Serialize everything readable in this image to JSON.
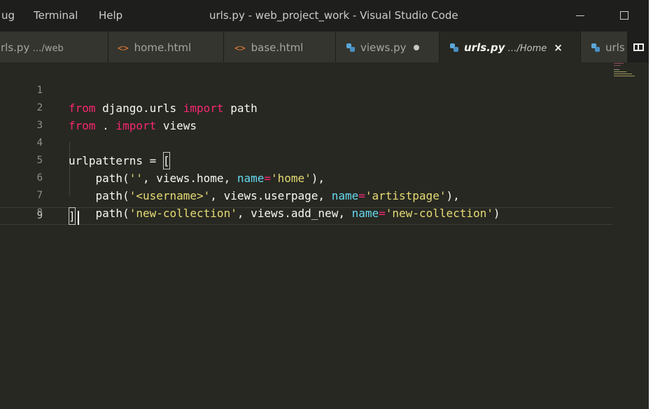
{
  "menu": {
    "items": [
      "ug",
      "Terminal",
      "Help"
    ]
  },
  "window": {
    "title": "urls.py - web_project_work - Visual Studio Code"
  },
  "tabs": [
    {
      "name": "rls.py",
      "path": " …/web",
      "icon": "python-icon",
      "active": false,
      "dirty": false
    },
    {
      "name": "home.html",
      "path": "",
      "icon": "html-icon",
      "active": false,
      "dirty": false
    },
    {
      "name": "base.html",
      "path": "",
      "icon": "html-icon",
      "active": false,
      "dirty": false
    },
    {
      "name": "views.py",
      "path": "",
      "icon": "python-icon",
      "active": false,
      "dirty": true
    },
    {
      "name": "urls.py",
      "path": " …/Home",
      "icon": "python-icon",
      "active": true,
      "dirty": false
    },
    {
      "name": "urls",
      "path": "",
      "icon": "python-icon",
      "active": false,
      "dirty": false
    }
  ],
  "tab_icons": {
    "html_glyph": "<>",
    "close_glyph": "×"
  },
  "editor": {
    "current_line": 9,
    "lines": [
      {
        "num": "1"
      },
      {
        "num": "2"
      },
      {
        "num": "3"
      },
      {
        "num": "4"
      },
      {
        "num": "5"
      },
      {
        "num": "6"
      },
      {
        "num": "7"
      },
      {
        "num": "8"
      },
      {
        "num": "9"
      }
    ],
    "tokens": {
      "l1_from": "from",
      "l1_mod": " django.urls ",
      "l1_import": "import",
      "l1_name": " path",
      "l2_from": "from",
      "l2_dot": " . ",
      "l2_import": "import",
      "l2_name": " views",
      "l4_var": "urlpatterns = ",
      "l4_bracket": "[",
      "l5_a": "    path(",
      "l5_str1": "''",
      "l5_b": ", views.home, ",
      "l5_param": "name",
      "l5_eq": "=",
      "l5_str2": "'home'",
      "l5_c": "),",
      "l6_a": "    path(",
      "l6_str1": "'<username>'",
      "l6_b": ", views.userpage, ",
      "l6_param": "name",
      "l6_eq": "=",
      "l6_str2": "'artistpage'",
      "l6_c": "),",
      "l7_a": "    path(",
      "l7_str1": "'new-collection'",
      "l7_b": ", views.add_new, ",
      "l7_param": "name",
      "l7_eq": "=",
      "l7_str2": "'new-collection'",
      "l7_c": ")",
      "l9_bracket": "]"
    }
  },
  "colors": {
    "editor_bg": "#272822",
    "keyword": "#f92672",
    "string": "#e6db74",
    "parameter": "#66d9ef",
    "text": "#f8f8f2"
  }
}
